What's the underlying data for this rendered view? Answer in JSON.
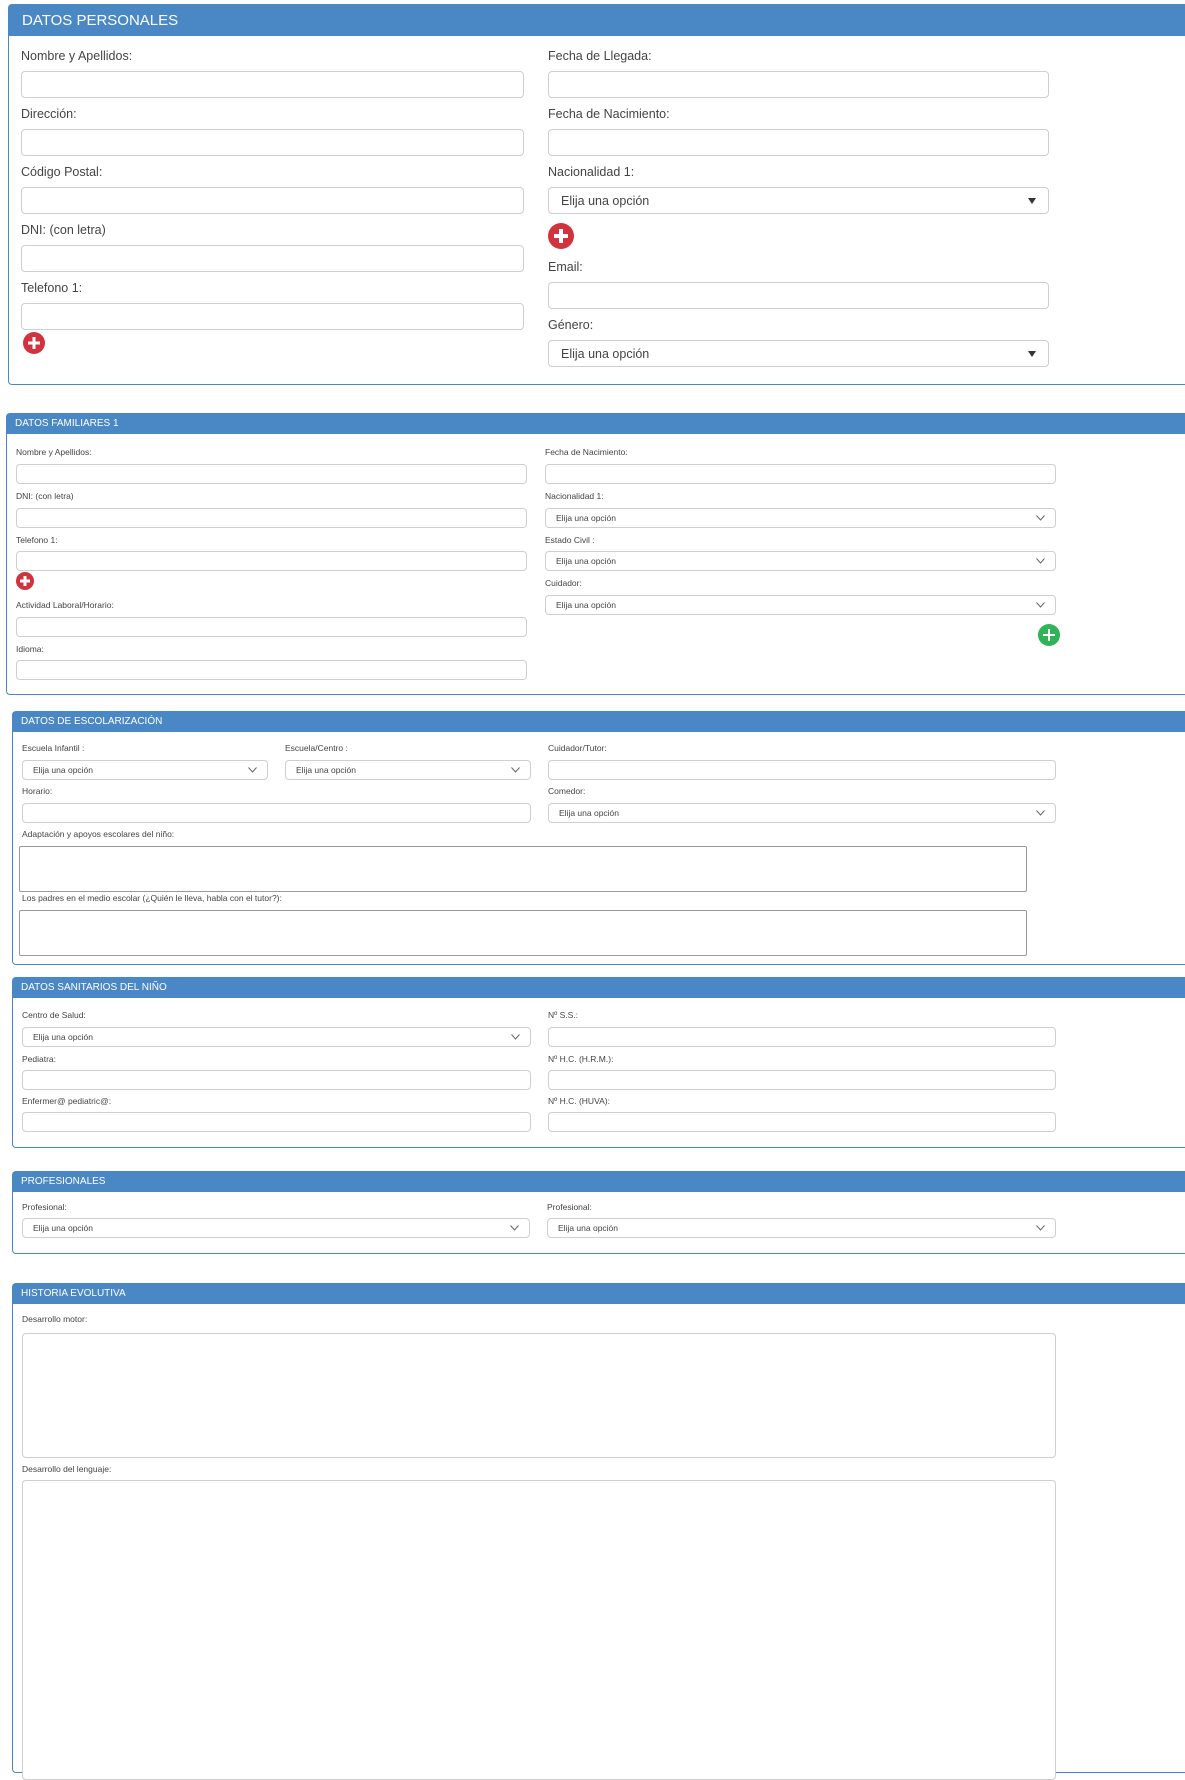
{
  "datos_personales": {
    "title": "DATOS PERSONALES",
    "nombre_label": "Nombre y Apellidos:",
    "direccion_label": "Dirección:",
    "cp_label": "Código Postal:",
    "dni_label": "DNI: (con letra)",
    "telefono_label": "Telefono 1:",
    "llegada_label": "Fecha de Llegada:",
    "nacimiento_label": "Fecha de Nacimiento:",
    "nacionalidad_label": "Nacionalidad 1:",
    "nacionalidad_value": "Elija una opción",
    "email_label": "Email:",
    "genero_label": "Género:",
    "genero_value": "Elija una opción"
  },
  "datos_familiares": {
    "title": "DATOS FAMILIARES 1",
    "nombre_label": "Nombre y Apellidos:",
    "dni_label": "DNI: (con letra)",
    "telefono_label": "Telefono 1:",
    "actividad_label": "Actividad Laboral/Horario:",
    "idioma_label": "Idioma:",
    "nacimiento_label": "Fecha de Nacimiento:",
    "nacionalidad_label": "Nacionalidad 1:",
    "nacionalidad_value": "Elija una opción",
    "estado_civil_label": "Estado Civil :",
    "estado_civil_value": "Elija una opción",
    "cuidador_label": "Cuidador:",
    "cuidador_value": "Elija una opción"
  },
  "escolarizacion": {
    "title": "DATOS DE ESCOLARIZACIÓN",
    "escuela_infantil_label": "Escuela Infantil :",
    "escuela_infantil_value": "Elija una opción",
    "escuela_centro_label": "Escuela/Centro :",
    "escuela_centro_value": "Elija una opción",
    "cuidador_tutor_label": "Cuidador/Tutor:",
    "horario_label": "Horario:",
    "comedor_label": "Comedor:",
    "comedor_value": "Elija una opción",
    "adaptacion_label": "Adaptación y apoyos escolares del niño:",
    "padres_label": "Los padres en el medio escolar (¿Quién le lleva, habla con el tutor?):"
  },
  "sanitarios": {
    "title": "DATOS SANITARIOS DEL NIÑO",
    "centro_salud_label": "Centro de Salud:",
    "centro_salud_value": "Elija una opción",
    "pediatra_label": "Pediatra:",
    "enfermera_label": "Enfermer@ pediatric@:",
    "ss_label": "Nº S.S.:",
    "hc_hrm_label": "Nº H.C. (H.R.M.):",
    "hc_huva_label": "Nº H.C. (HUVA):"
  },
  "profesionales": {
    "title": "PROFESIONALES",
    "profesional1_label": "Profesional:",
    "profesional1_value": "Elija una opción",
    "profesional2_label": "Profesional:",
    "profesional2_value": "Elija una opción"
  },
  "historia": {
    "title": "HISTORIA EVOLUTIVA",
    "motor_label": "Desarrollo motor:",
    "lenguaje_label": "Desarrollo del lenguaje:"
  },
  "icons": {
    "plus_red": "plus-circle-icon",
    "plus_green": "plus-circle-icon",
    "caret": "caret-down-icon",
    "chevron": "chevron-down-icon"
  },
  "colors": {
    "header": "#4a87c5",
    "plus_red": "#d0333d",
    "plus_green": "#2fb457"
  }
}
